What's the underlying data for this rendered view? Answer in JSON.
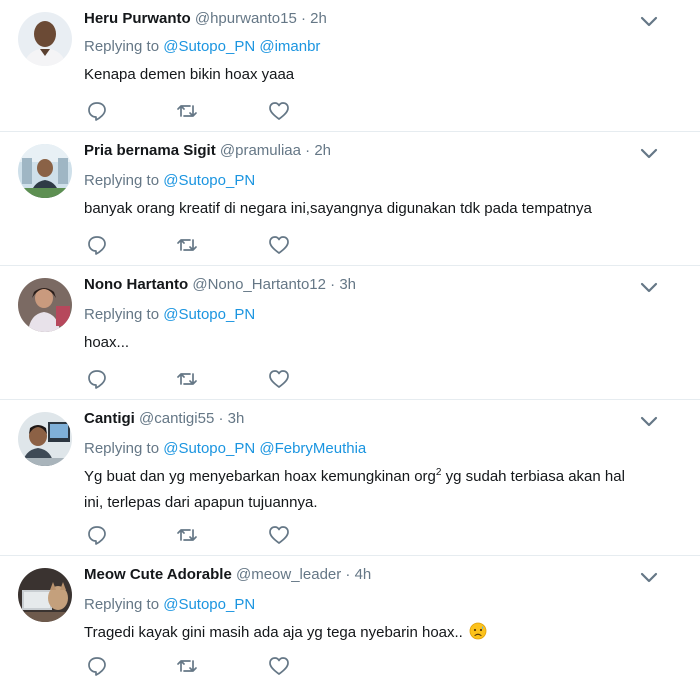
{
  "colors": {
    "accent": "#1b95e0",
    "muted": "#657786",
    "text": "#14171a",
    "divider": "#e6ecf0"
  },
  "icons": {
    "reply": "reply-icon",
    "retweet": "retweet-icon",
    "like": "heart-icon",
    "menu": "chevron-down-icon"
  },
  "tweets": [
    {
      "name": "Heru Purwanto",
      "handle": "@hpurwanto15",
      "time": "2h",
      "replying_prefix": "Replying to",
      "mentions": [
        "@Sutopo_PN",
        "@imanbr"
      ],
      "text": "Kenapa demen bikin hoax yaaa"
    },
    {
      "name": "Pria bernama Sigit",
      "handle": "@pramuliaa",
      "time": "2h",
      "replying_prefix": "Replying to",
      "mentions": [
        "@Sutopo_PN"
      ],
      "text": "banyak orang kreatif di negara ini,sayangnya digunakan tdk pada tempatnya"
    },
    {
      "name": "Nono Hartanto",
      "handle": "@Nono_Hartanto12",
      "time": "3h",
      "replying_prefix": "Replying to",
      "mentions": [
        "@Sutopo_PN"
      ],
      "text": "hoax..."
    },
    {
      "name": "Cantigi",
      "handle": "@cantigi55",
      "time": "3h",
      "replying_prefix": "Replying to",
      "mentions": [
        "@Sutopo_PN",
        "@FebryMeuthia"
      ],
      "text_line1_a": "Yg buat dan yg menyebarkan hoax kemungkinan org",
      "text_line1_sup": "2",
      "text_line1_b": " yg sudah terbiasa akan hal",
      "text_line2": "ini, terlepas dari apapun tujuannya."
    },
    {
      "name": "Meow Cute Adorable",
      "handle": "@meow_leader",
      "time": "4h",
      "replying_prefix": "Replying to",
      "mentions": [
        "@Sutopo_PN"
      ],
      "text": "Tragedi kayak gini masih ada aja yg tega nyebarin hoax..",
      "emoji": "disappointed-relieved-face-emoji"
    }
  ]
}
